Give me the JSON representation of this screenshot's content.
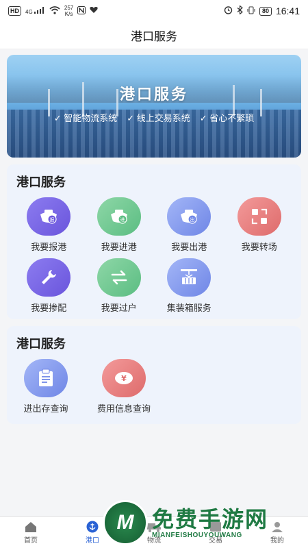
{
  "status_bar": {
    "left_badge": "HD",
    "network": "4G",
    "speed_value": "257",
    "speed_unit": "K/s",
    "battery": "80",
    "time": "16:41"
  },
  "navbar": {
    "title": "港口服务"
  },
  "banner": {
    "title": "港口服务",
    "tags": [
      "✓ 智能物流系统",
      "✓ 线上交易系统",
      "✓ 省心不繁琐"
    ]
  },
  "section1": {
    "title": "港口服务",
    "items": [
      {
        "label": "我要报港",
        "icon": "ship-report-icon",
        "color": "#7563e4",
        "glyph": "报"
      },
      {
        "label": "我要进港",
        "icon": "ship-enter-icon",
        "color": "#6cc58f",
        "glyph": "进"
      },
      {
        "label": "我要出港",
        "icon": "ship-exit-icon",
        "color": "#8599ee",
        "glyph": "出"
      },
      {
        "label": "我要转场",
        "icon": "transfer-icon",
        "color": "#e57878"
      },
      {
        "label": "我要掺配",
        "icon": "wrench-icon",
        "color": "#7563e4"
      },
      {
        "label": "我要过户",
        "icon": "swap-arrows-icon",
        "color": "#6cc58f"
      },
      {
        "label": "集装箱服务",
        "icon": "container-crane-icon",
        "color": "#8599ee"
      }
    ]
  },
  "section2": {
    "title": "港口服务",
    "items": [
      {
        "label": "进出存查询",
        "icon": "clipboard-icon",
        "color": "#8599ee"
      },
      {
        "label": "费用信息查询",
        "icon": "yuan-coin-icon",
        "color": "#e57878",
        "glyph": "¥"
      }
    ]
  },
  "tabbar": {
    "tabs": [
      {
        "label": "首页",
        "icon": "home-icon",
        "active": false
      },
      {
        "label": "港口",
        "icon": "anchor-icon",
        "active": true
      },
      {
        "label": "物流",
        "icon": "truck-icon",
        "active": false
      },
      {
        "label": "交易",
        "icon": "trade-icon",
        "active": false
      },
      {
        "label": "我的",
        "icon": "user-icon",
        "active": false
      }
    ]
  },
  "watermark": {
    "logo_letter": "M",
    "text_cn": "免费手游网",
    "text_en": "MIANFEISHOUYOUWANG"
  }
}
